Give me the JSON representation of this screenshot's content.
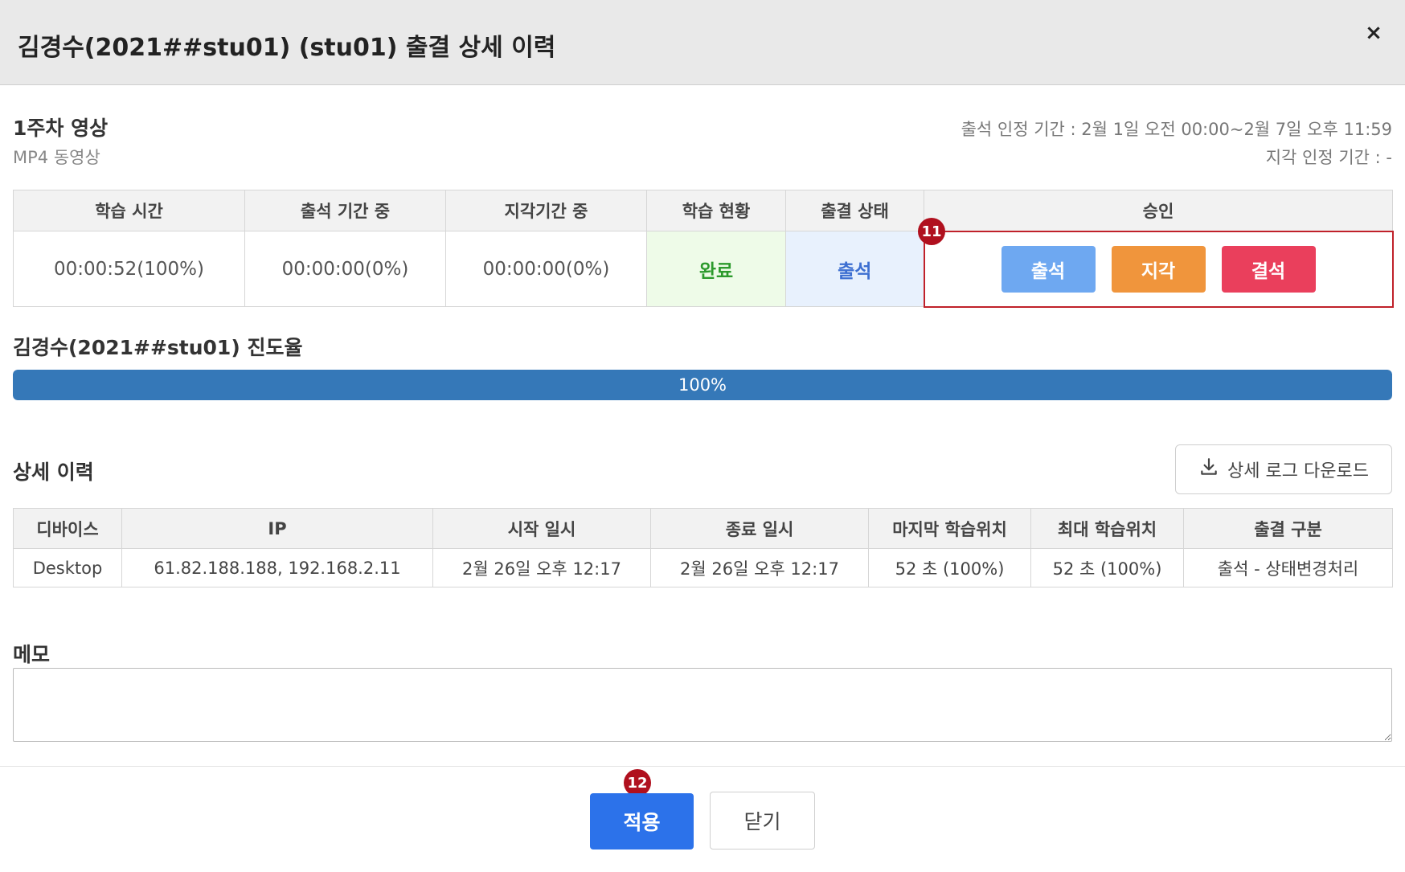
{
  "dialog": {
    "title": "김경수(2021##stu01) (stu01) 출결 상세 이력",
    "close_symbol": "×"
  },
  "content": {
    "title": "1주차 영상",
    "subtitle": "MP4 동영상",
    "attendance_period": "출석 인정 기간 : 2월 1일 오전 00:00~2월 7일 오후 11:59",
    "late_period": "지각 인정 기간 : -"
  },
  "attendance_table": {
    "headers": [
      "학습 시간",
      "출석 기간 중",
      "지각기간 중",
      "학습 현황",
      "출결 상태",
      "승인"
    ],
    "row": {
      "study_time": "00:00:52(100%)",
      "attend_period_time": "00:00:00(0%)",
      "late_period_time": "00:00:00(0%)",
      "learning_status": "완료",
      "attendance_status": "출석"
    },
    "approve_buttons": {
      "present": "출석",
      "late": "지각",
      "absent": "결석"
    }
  },
  "badges": {
    "approve": "11",
    "apply": "12"
  },
  "progress": {
    "label": "김경수(2021##stu01) 진도율",
    "value": 1.0,
    "text": "100%"
  },
  "detail": {
    "title": "상세 이력",
    "download_label": "상세 로그 다운로드",
    "headers": [
      "디바이스",
      "IP",
      "시작 일시",
      "종료 일시",
      "마지막 학습위치",
      "최대 학습위치",
      "출결 구분"
    ],
    "rows": [
      {
        "device": "Desktop",
        "ip": "61.82.188.188, 192.168.2.11",
        "start": "2월 26일 오후 12:17",
        "end": "2월 26일 오후 12:17",
        "last_position": "52 초 (100%)",
        "max_position": "52 초 (100%)",
        "attendance_type": "출석 - 상태변경처리"
      }
    ]
  },
  "memo": {
    "label": "메모",
    "value": ""
  },
  "footer": {
    "apply_label": "적용",
    "close_label": "닫기"
  },
  "colors": {
    "present": "#6ea8f1",
    "late": "#f0953c",
    "absent": "#ea3f5c",
    "apply": "#2c72ea",
    "progress": "#3578b8",
    "badge": "#b0101e",
    "highlight_border": "#c0212a"
  }
}
